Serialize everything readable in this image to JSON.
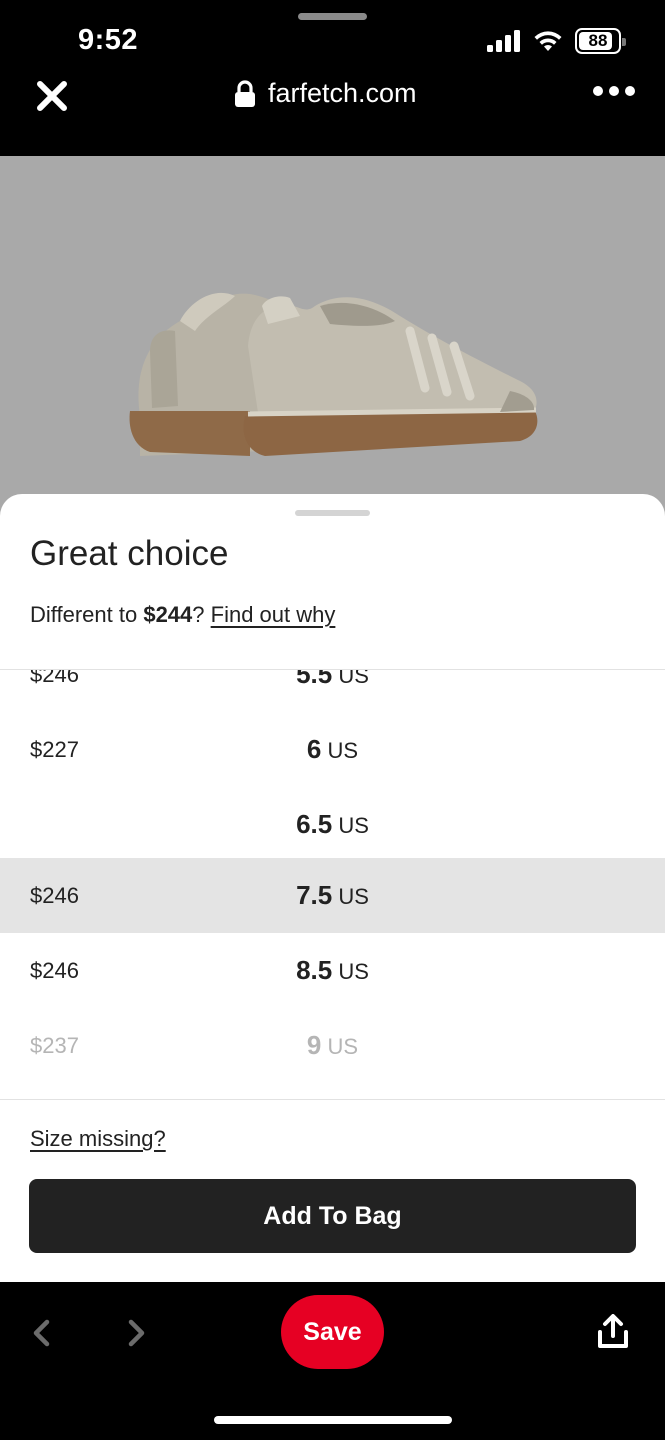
{
  "status_bar": {
    "time": "9:52",
    "battery": "88"
  },
  "browser": {
    "url": "farfetch.com"
  },
  "sheet": {
    "title": "Great choice",
    "diff_prefix": "Different to ",
    "diff_price": "$244",
    "diff_suffix": "? ",
    "diff_link": "Find out why",
    "sizes": [
      {
        "price": "$246",
        "size": "5.5",
        "unit": "US"
      },
      {
        "price": "$227",
        "size": "6",
        "unit": "US"
      },
      {
        "price": "",
        "size": "6.5",
        "unit": "US"
      },
      {
        "price": "$246",
        "size": "7.5",
        "unit": "US"
      },
      {
        "price": "$246",
        "size": "8.5",
        "unit": "US"
      },
      {
        "price": "$237",
        "size": "9",
        "unit": "US"
      }
    ],
    "size_missing": "Size missing?",
    "add_to_bag": "Add To Bag"
  },
  "toolbar": {
    "save": "Save"
  },
  "colors": {
    "save": "#e60023",
    "button": "#222222",
    "selected_row": "#e4e4e4"
  }
}
